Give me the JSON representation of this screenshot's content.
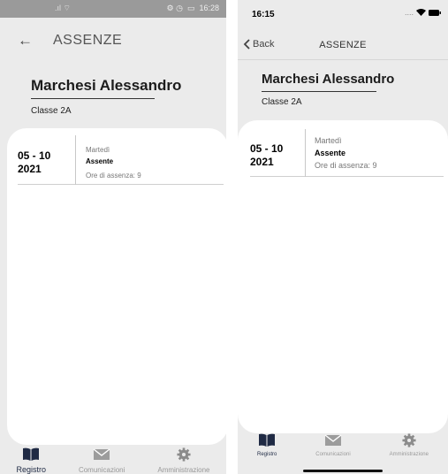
{
  "android": {
    "status_time": "16:28",
    "title": "ASSENZE",
    "student_name": "Marchesi Alessandro",
    "class_label": "Classe 2A",
    "entry": {
      "date": "05 - 10\n2021",
      "weekday": "Martedì",
      "status": "Assente",
      "hours": "Ore di assenza: 9"
    },
    "tabs": [
      {
        "label": "Registro",
        "icon": "book-icon"
      },
      {
        "label": "Comunicazioni",
        "icon": "mail-icon"
      },
      {
        "label": "Amministrazione",
        "icon": "gear-icon"
      }
    ]
  },
  "ios": {
    "status_time": "16:15",
    "status_dots": "....",
    "back_label": "Back",
    "title": "ASSENZE",
    "student_name": "Marchesi Alessandro",
    "class_label": "Classe 2A",
    "entry": {
      "date": "05 - 10\n2021",
      "weekday": "Martedì",
      "status": "Assente",
      "hours": "Ore di assenza: 9"
    },
    "tabs": [
      {
        "label": "Registro",
        "icon": "book-icon"
      },
      {
        "label": "Comunicazioni",
        "icon": "mail-icon"
      },
      {
        "label": "Amministrazione",
        "icon": "gear-icon"
      }
    ]
  },
  "colors": {
    "background": "#ebebeb",
    "card": "#ffffff",
    "active_tab": "#1f2a44",
    "inactive_tab": "#999999"
  }
}
